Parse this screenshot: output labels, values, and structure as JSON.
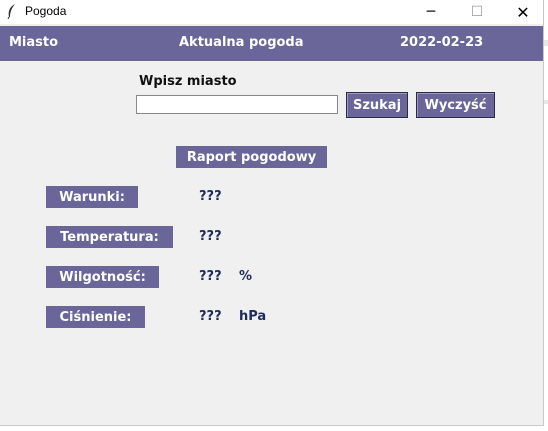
{
  "window": {
    "title": "Pogoda",
    "icon": "feather-icon"
  },
  "header": {
    "city_label": "Miasto",
    "current_label": "Aktualna pogoda",
    "date": "2022-02-23"
  },
  "search": {
    "prompt": "Wpisz miasto",
    "input_value": "",
    "search_label": "Szukaj",
    "clear_label": "Wyczyść"
  },
  "report": {
    "title": "Raport pogodowy",
    "rows": [
      {
        "label": "Warunki:",
        "value": "???",
        "unit": ""
      },
      {
        "label": "Temperatura:",
        "value": "???",
        "unit": ""
      },
      {
        "label": "Wilgotność:",
        "value": "???",
        "unit": "%"
      },
      {
        "label": "Ciśnienie:",
        "value": "???",
        "unit": "hPa"
      }
    ]
  },
  "colors": {
    "accent": "#6a6699",
    "value_text": "#1e2b5a",
    "background": "#f0f0f0"
  }
}
